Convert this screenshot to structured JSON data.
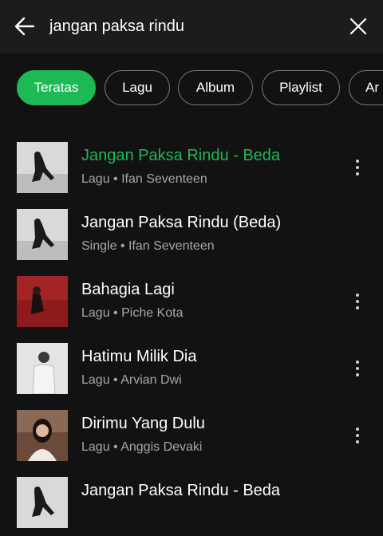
{
  "search": {
    "query": "jangan paksa rindu"
  },
  "filters": [
    "Teratas",
    "Lagu",
    "Album",
    "Playlist",
    "Ar"
  ],
  "results": [
    {
      "title": "Jangan Paksa Rindu - Beda",
      "subtitle": "Lagu • Ifan Seventeen",
      "playing": true,
      "has_menu": true,
      "thumb": "dark"
    },
    {
      "title": "Jangan Paksa Rindu (Beda)",
      "subtitle": "Single • Ifan Seventeen",
      "playing": false,
      "has_menu": false,
      "thumb": "dark"
    },
    {
      "title": "Bahagia Lagi",
      "subtitle": "Lagu • Piche Kota",
      "playing": false,
      "has_menu": true,
      "thumb": "red"
    },
    {
      "title": "Hatimu Milik Dia",
      "subtitle": "Lagu • Arvian Dwi",
      "playing": false,
      "has_menu": true,
      "thumb": "light"
    },
    {
      "title": "Dirimu Yang Dulu",
      "subtitle": "Lagu • Anggis Devaki",
      "playing": false,
      "has_menu": true,
      "thumb": "portrait"
    },
    {
      "title": "Jangan Paksa Rindu - Beda",
      "subtitle": "",
      "playing": false,
      "has_menu": false,
      "thumb": "dark"
    }
  ],
  "colors": {
    "accent": "#1db954",
    "background": "#121212",
    "topbar": "#1c1c1c"
  }
}
